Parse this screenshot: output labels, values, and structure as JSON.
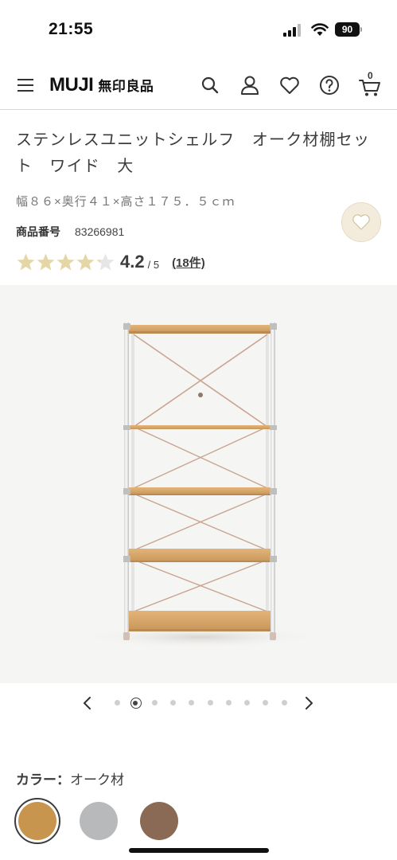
{
  "status_bar": {
    "time": "21:55",
    "battery": "90"
  },
  "header": {
    "logo_en": "MUJI",
    "logo_jp": "無印良品",
    "icons": [
      "menu-icon",
      "search-icon",
      "account-icon",
      "favorites-icon",
      "help-icon",
      "cart-icon"
    ],
    "cart_count": "0"
  },
  "product": {
    "title": "ステンレスユニットシェルフ　オーク材棚セット　ワイド　大",
    "size": "幅８６×奥行４１×高さ１７５．５ｃｍ",
    "number_label": "商品番号",
    "number": "83266981"
  },
  "rating": {
    "value": "4.2",
    "max": "/ 5",
    "count": "(18件)",
    "stars_total": 5,
    "stars_value": 4.2,
    "star_color": "#e5d6a8",
    "star_empty_color": "#e6e6e6"
  },
  "carousel": {
    "total": 10,
    "active_index": 1
  },
  "color_selector": {
    "label": "カラー：",
    "selected": "オーク材",
    "swatches": [
      {
        "name": "swatch-oak",
        "color": "#c8954e",
        "selected": true
      },
      {
        "name": "swatch-gray",
        "color": "#b8b9bb",
        "selected": false
      },
      {
        "name": "swatch-walnut",
        "color": "#8a6a55",
        "selected": false
      }
    ]
  }
}
